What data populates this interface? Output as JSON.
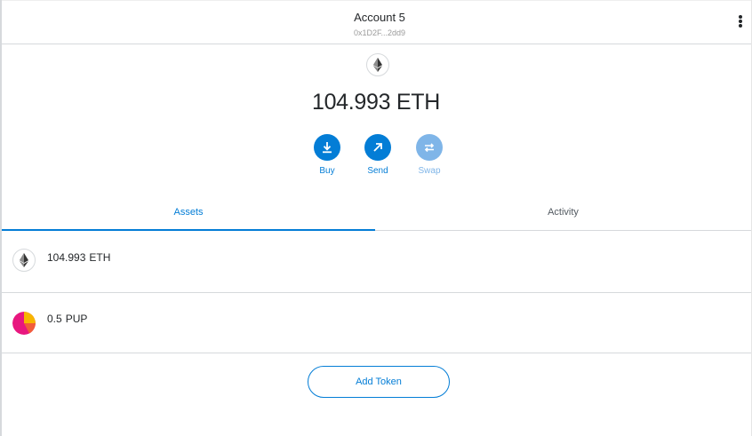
{
  "header": {
    "account_name": "Account 5",
    "account_address": "0x1D2F...2dd9",
    "menu_icon": "kebab-menu-icon"
  },
  "overview": {
    "token_icon": "ethereum-icon",
    "balance_value": "104.993",
    "balance_symbol": "ETH",
    "actions": [
      {
        "label": "Buy",
        "icon": "download-arrow-icon",
        "enabled": true
      },
      {
        "label": "Send",
        "icon": "diagonal-arrow-icon",
        "enabled": true
      },
      {
        "label": "Swap",
        "icon": "swap-arrows-icon",
        "enabled": false
      }
    ]
  },
  "tabs": [
    {
      "label": "Assets",
      "active": true
    },
    {
      "label": "Activity",
      "active": false
    }
  ],
  "assets": [
    {
      "amount": "104.993",
      "symbol": "ETH",
      "icon": "ethereum-icon"
    },
    {
      "amount": "0.5",
      "symbol": "PUP",
      "icon": "pup-token-icon"
    }
  ],
  "add_token_label": "Add Token",
  "colors": {
    "accent": "#037dd6",
    "accent_disabled": "#7fb5e8",
    "text": "#24272a",
    "muted": "#9b9b9b",
    "divider": "#d6d9dc",
    "pup_pink": "#e8177f",
    "pup_yellow": "#f7b500"
  }
}
